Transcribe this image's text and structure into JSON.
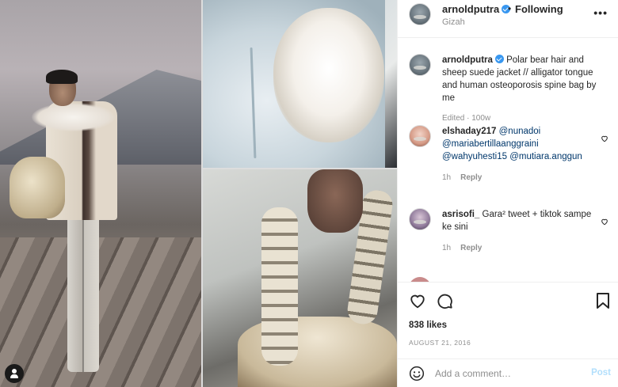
{
  "post": {
    "username": "arnoldputra",
    "follow_separator": "•",
    "follow_label": "Following",
    "location": "Gizah",
    "more_label": "•••"
  },
  "caption": {
    "username": "arnoldputra",
    "text": "Polar bear hair and sheep suede jacket // alligator tongue and human osteoporosis spine bag by me",
    "edited_label": "Edited",
    "age": "100w"
  },
  "comments": [
    {
      "username": "elshaday217",
      "mentions": [
        "@nunadoi",
        "@mariabertillaanggraini",
        "@wahyuhesti15",
        "@mutiara.anggun"
      ],
      "age": "1h",
      "reply_label": "Reply"
    },
    {
      "username": "asrisofi_",
      "text": "Gara² tweet + tiktok sampe ke sini",
      "age": "1h",
      "reply_label": "Reply"
    }
  ],
  "engagement": {
    "likes": "838 likes",
    "date": "AUGUST 21, 2016"
  },
  "composer": {
    "placeholder": "Add a comment…",
    "post_label": "Post"
  },
  "colors": {
    "link": "#00376b",
    "verified": "#3897f0",
    "muted": "#8e8e8e",
    "post_disabled": "#b2dffc"
  },
  "icons": [
    "heart-icon",
    "comment-icon",
    "bookmark-icon",
    "smiley-icon",
    "verified-badge-icon",
    "user-tag-icon",
    "more-options-icon"
  ]
}
